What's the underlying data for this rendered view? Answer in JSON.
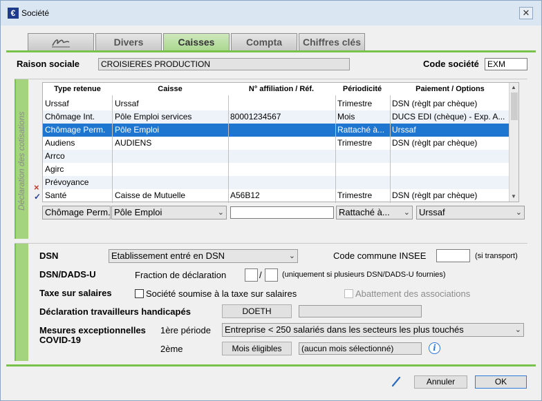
{
  "window": {
    "title": "Société",
    "app_icon": "€"
  },
  "tabs": [
    {
      "label": "",
      "icon": "signature-icon"
    },
    {
      "label": "Divers"
    },
    {
      "label": "Caisses",
      "active": true
    },
    {
      "label": "Compta"
    },
    {
      "label": "Chiffres clés"
    }
  ],
  "header": {
    "raison_label": "Raison sociale",
    "raison_value": "CROISIERES PRODUCTION",
    "code_label": "Code société",
    "code_value": "EXM"
  },
  "cotisations": {
    "side_label": "Déclaration des cotisations",
    "columns": [
      "Type retenue",
      "Caisse",
      "N° affiliation / Réf.",
      "Périodicité",
      "Paiement / Options"
    ],
    "rows": [
      [
        "Urssaf",
        "Urssaf",
        "",
        "Trimestre",
        "DSN (règlt par chèque)"
      ],
      [
        "Chômage Int.",
        "Pôle Emploi services",
        "80001234567",
        "Mois",
        "DUCS EDI (chèque) - Exp. A..."
      ],
      [
        "Chômage Perm.",
        "Pôle Emploi",
        "",
        "Rattaché à...",
        "Urssaf"
      ],
      [
        "Audiens",
        "AUDIENS",
        "",
        "Trimestre",
        "DSN (règlt par chèque)"
      ],
      [
        "Arrco",
        "",
        "",
        "",
        ""
      ],
      [
        "Agirc",
        "",
        "",
        "",
        ""
      ],
      [
        "Prévoyance",
        "",
        "",
        "",
        ""
      ],
      [
        "Santé",
        "Caisse de Mutuelle",
        "A56B12",
        "Trimestre",
        "DSN (règlt par chèque)"
      ]
    ],
    "selected_row": 2,
    "row_markers": {
      "delete": "×",
      "validate": "✓"
    },
    "edit": {
      "type": "Chômage Perm.",
      "caisse": "Pôle Emploi",
      "affiliation": "",
      "periodicite": "Rattaché à...",
      "paiement": "Urssaf"
    }
  },
  "dsn": {
    "dsn_label": "DSN",
    "dsn_value": "Etablissement entré en DSN",
    "commune_label": "Code commune INSEE",
    "commune_value": "",
    "commune_note": "(si transport)",
    "dads_label": "DSN/DADS-U",
    "fraction_label": "Fraction de déclaration",
    "fraction_a": "",
    "fraction_sep": "/",
    "fraction_b": "",
    "fraction_note": "(uniquement si plusieurs DSN/DADS-U fournies)",
    "taxe_label": "Taxe sur salaires",
    "taxe_checkbox": "Société soumise à la taxe sur salaires",
    "abattement_checkbox": "Abattement des associations",
    "handicap_label": "Déclaration travailleurs handicapés",
    "doeth_button": "DOETH",
    "handicap_value": "",
    "covid_label_1": "Mesures exceptionnelles",
    "covid_label_2": "COVID-19",
    "periode1_label": "1ère période",
    "periode1_value": "Entreprise < 250 salariés dans les secteurs les plus touchés",
    "periode2_label": "2ème",
    "mois_button": "Mois éligibles",
    "mois_value": "(aucun mois sélectionné)",
    "info_icon": "i"
  },
  "footer": {
    "cancel_label": "Annuler",
    "ok_label": "OK"
  }
}
